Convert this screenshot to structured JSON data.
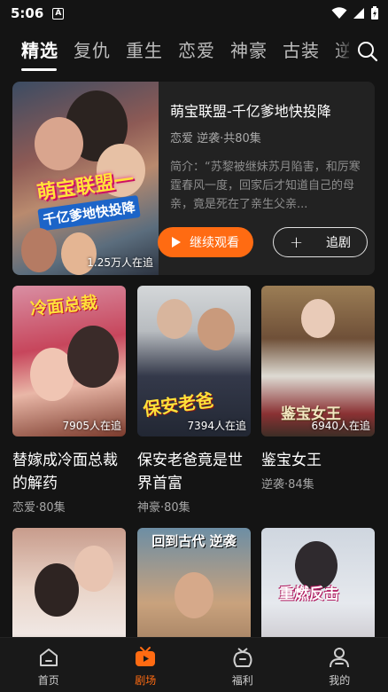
{
  "status": {
    "time": "5:06",
    "notif_glyph": "A"
  },
  "tabs": [
    {
      "label": "精选",
      "active": true
    },
    {
      "label": "复仇"
    },
    {
      "label": "重生"
    },
    {
      "label": "恋爱"
    },
    {
      "label": "神豪"
    },
    {
      "label": "古装"
    },
    {
      "label": "逆"
    }
  ],
  "featured": {
    "title": "萌宝联盟-千亿爹地快投降",
    "meta": "恋爱 逆袭·共80集",
    "intro": "简介：“苏黎被继妹苏月陷害，和厉寒霆春风一度，回家后才知道自己的母亲，竟是死在了亲生父亲...",
    "followers": "1.25万人在追",
    "poster_line1": "萌宝联盟一",
    "poster_line2": "千亿爹地快投降",
    "watch_label": "继续观看",
    "follow_label": "追剧",
    "accent": "#ff6b12"
  },
  "cards": [
    {
      "title": "替嫁成冷面总裁的解药",
      "meta": "恋爱·80集",
      "followers": "7905人在追",
      "art": "冷面总裁"
    },
    {
      "title": "保安老爸竟是世界首富",
      "meta": "神豪·80集",
      "followers": "7394人在追",
      "art": "保安老爸"
    },
    {
      "title": "鉴宝女王",
      "meta": "逆袭·84集",
      "followers": "6940人在追",
      "art": "鉴宝女王"
    },
    {
      "art": ""
    },
    {
      "art": "回到古代 逆袭"
    },
    {
      "art": "重燃反击"
    }
  ],
  "nav": [
    {
      "label": "首页",
      "icon": "home-icon"
    },
    {
      "label": "剧场",
      "icon": "tv-icon",
      "active": true
    },
    {
      "label": "福利",
      "icon": "gift-bag-icon"
    },
    {
      "label": "我的",
      "icon": "user-icon"
    }
  ]
}
